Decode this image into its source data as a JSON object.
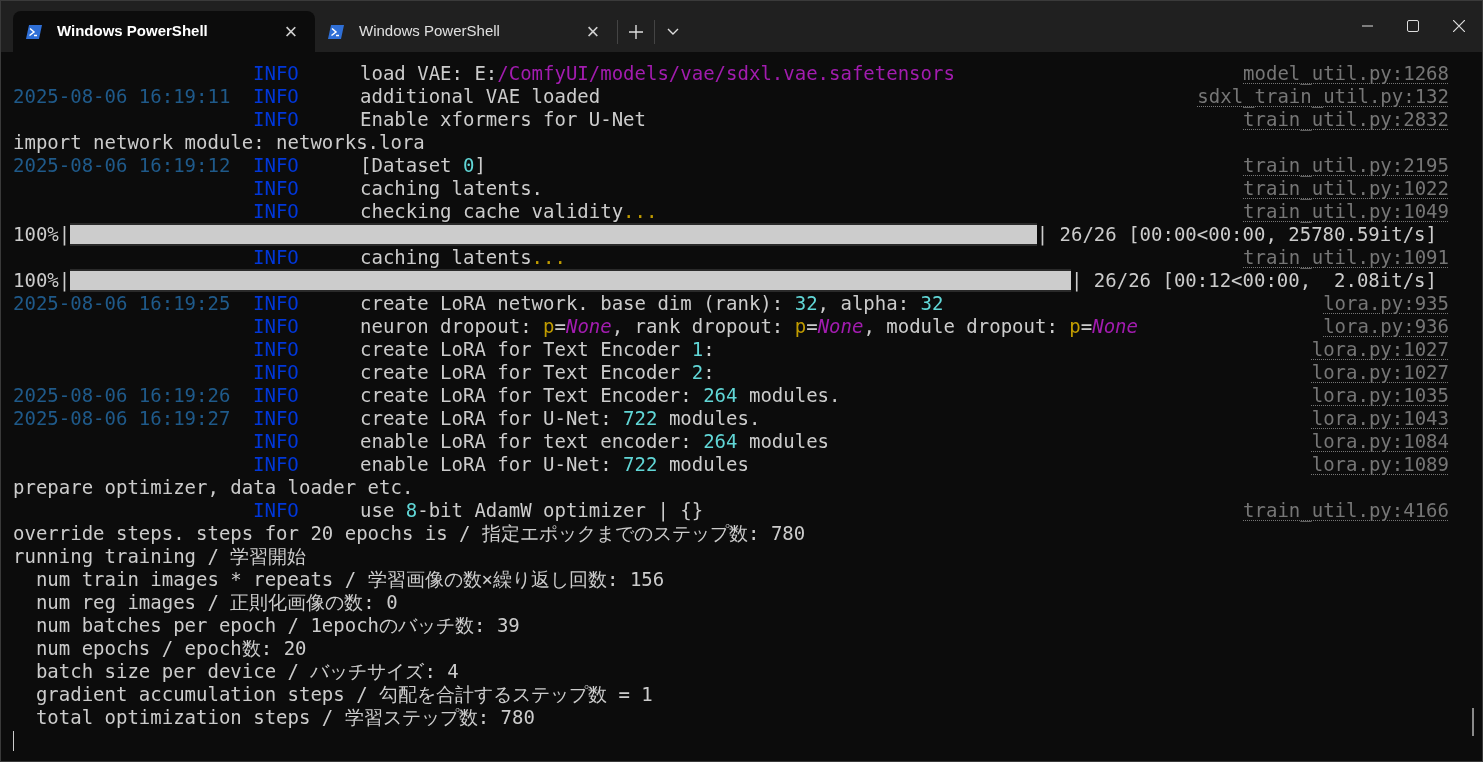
{
  "tabs": [
    {
      "title": "Windows PowerShell",
      "selected": true,
      "close": "×"
    },
    {
      "title": "Windows PowerShell",
      "selected": false,
      "close": "×"
    }
  ],
  "lines": [
    {
      "kind": "log",
      "level": "INFO",
      "message": [
        {
          "kind": "text",
          "text": "load VAE: E:"
        },
        {
          "kind": "path",
          "text": "/ComfyUI/models/vae/sdxl.vae.safetensors"
        }
      ],
      "source": "model_util.py:1268"
    },
    {
      "kind": "log",
      "time": "2025-08-06 16:19:11",
      "level": "INFO",
      "message": [
        {
          "kind": "text",
          "text": "additional VAE loaded"
        }
      ],
      "source": "sdxl_train_util.py:132"
    },
    {
      "kind": "log",
      "level": "INFO",
      "message": [
        {
          "kind": "text",
          "text": "Enable xformers for U-Net"
        }
      ],
      "source": "train_util.py:2832"
    },
    {
      "kind": "plain",
      "text": "import network module: networks.lora"
    },
    {
      "kind": "log",
      "time": "2025-08-06 16:19:12",
      "level": "INFO",
      "message": [
        {
          "kind": "text",
          "text": "[Dataset "
        },
        {
          "kind": "number",
          "text": "0"
        },
        {
          "kind": "text",
          "text": "]"
        }
      ],
      "source": "train_util.py:2195"
    },
    {
      "kind": "log",
      "level": "INFO",
      "message": [
        {
          "kind": "text",
          "text": "caching latents."
        }
      ],
      "source": "train_util.py:1022"
    },
    {
      "kind": "log",
      "level": "INFO",
      "message": [
        {
          "kind": "text",
          "text": "checking cache validity"
        },
        {
          "kind": "ellipsis",
          "text": "..."
        }
      ],
      "source": "train_util.py:1049"
    },
    {
      "kind": "progress",
      "text": "100%|",
      "level": 1,
      "suffix": "| 26/26 [00:00<00:00, 25780.59it/s]"
    },
    {
      "kind": "log",
      "level": "INFO",
      "message": [
        {
          "kind": "text",
          "text": "caching latents"
        },
        {
          "kind": "ellipsis",
          "text": "..."
        }
      ],
      "source": "train_util.py:1091"
    },
    {
      "kind": "progress",
      "text": "100%|",
      "level": 1,
      "suffix": "| 26/26 [00:12<00:00,  2.08it/s]"
    },
    {
      "kind": "log",
      "time": "2025-08-06 16:19:25",
      "level": "INFO",
      "message": [
        {
          "kind": "text",
          "text": "create LoRA network. base dim (rank): "
        },
        {
          "kind": "number",
          "text": "32"
        },
        {
          "kind": "text",
          "text": ", alpha: "
        },
        {
          "kind": "number",
          "text": "32"
        }
      ],
      "source": "lora.py:935"
    },
    {
      "kind": "log",
      "level": "INFO",
      "message": [
        {
          "kind": "text",
          "text": "neuron dropout: "
        },
        {
          "kind": "param",
          "text": "p"
        },
        {
          "kind": "text",
          "text": "="
        },
        {
          "kind": "none",
          "text": "None"
        },
        {
          "kind": "text",
          "text": ", rank dropout: "
        },
        {
          "kind": "param",
          "text": "p"
        },
        {
          "kind": "text",
          "text": "="
        },
        {
          "kind": "none",
          "text": "None"
        },
        {
          "kind": "text",
          "text": ", module dropout: "
        },
        {
          "kind": "param",
          "text": "p"
        },
        {
          "kind": "text",
          "text": "="
        },
        {
          "kind": "none",
          "text": "None"
        }
      ],
      "source": "lora.py:936"
    },
    {
      "kind": "log",
      "level": "INFO",
      "message": [
        {
          "kind": "text",
          "text": "create LoRA for Text Encoder "
        },
        {
          "kind": "number",
          "text": "1"
        },
        {
          "kind": "text",
          "text": ":"
        }
      ],
      "source": "lora.py:1027"
    },
    {
      "kind": "log",
      "level": "INFO",
      "message": [
        {
          "kind": "text",
          "text": "create LoRA for Text Encoder "
        },
        {
          "kind": "number",
          "text": "2"
        },
        {
          "kind": "text",
          "text": ":"
        }
      ],
      "source": "lora.py:1027"
    },
    {
      "kind": "log",
      "time": "2025-08-06 16:19:26",
      "level": "INFO",
      "message": [
        {
          "kind": "text",
          "text": "create LoRA for Text Encoder: "
        },
        {
          "kind": "number",
          "text": "264"
        },
        {
          "kind": "text",
          "text": " modules."
        }
      ],
      "source": "lora.py:1035"
    },
    {
      "kind": "log",
      "time": "2025-08-06 16:19:27",
      "level": "INFO",
      "message": [
        {
          "kind": "text",
          "text": "create LoRA for U-Net: "
        },
        {
          "kind": "number",
          "text": "722"
        },
        {
          "kind": "text",
          "text": " modules."
        }
      ],
      "source": "lora.py:1043"
    },
    {
      "kind": "log",
      "level": "INFO",
      "message": [
        {
          "kind": "text",
          "text": "enable LoRA for text encoder: "
        },
        {
          "kind": "number",
          "text": "264"
        },
        {
          "kind": "text",
          "text": " modules"
        }
      ],
      "source": "lora.py:1084"
    },
    {
      "kind": "log",
      "level": "INFO",
      "message": [
        {
          "kind": "text",
          "text": "enable LoRA for U-Net: "
        },
        {
          "kind": "number",
          "text": "722"
        },
        {
          "kind": "text",
          "text": " modules"
        }
      ],
      "source": "lora.py:1089"
    },
    {
      "kind": "plain",
      "text": "prepare optimizer, data loader etc."
    },
    {
      "kind": "log",
      "level": "INFO",
      "message": [
        {
          "kind": "text",
          "text": "use "
        },
        {
          "kind": "number",
          "text": "8"
        },
        {
          "kind": "text",
          "text": "-bit AdamW optimizer | {}"
        }
      ],
      "source": "train_util.py:4166"
    },
    {
      "kind": "plain",
      "text": "override steps. steps for 20 epochs is / 指定エポックまでのステップ数: 780"
    },
    {
      "kind": "plain",
      "text": "running training / 学習開始"
    },
    {
      "kind": "plain",
      "text": "  num train images * repeats / 学習画像の数×繰り返し回数: 156"
    },
    {
      "kind": "plain",
      "text": "  num reg images / 正則化画像の数: 0"
    },
    {
      "kind": "plain",
      "text": "  num batches per epoch / 1epochのバッチ数: 39"
    },
    {
      "kind": "plain",
      "text": "  num epochs / epoch数: 20"
    },
    {
      "kind": "plain",
      "text": "  batch size per device / バッチサイズ: 4"
    },
    {
      "kind": "plain",
      "text": "  gradient accumulation steps / 勾配を合計するステップ数 = 1"
    },
    {
      "kind": "plain",
      "text": "  total optimization steps / 学習ステップ数: 780"
    }
  ]
}
